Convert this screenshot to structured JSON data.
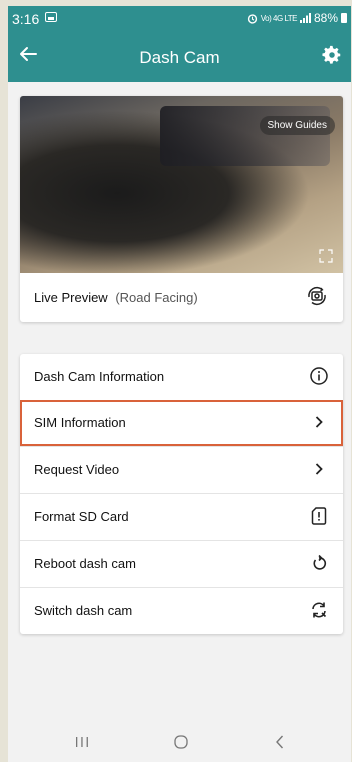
{
  "status_bar": {
    "time": "3:16",
    "network_label": "Vo) 4G LTE",
    "battery": "88%"
  },
  "header": {
    "title": "Dash Cam"
  },
  "preview": {
    "show_guides_label": "Show Guides",
    "label": "Live Preview",
    "sub_label": "(Road Facing)"
  },
  "menu": {
    "items": [
      {
        "label": "Dash Cam Information",
        "icon": "info-icon"
      },
      {
        "label": "SIM Information",
        "icon": "chevron-right-icon",
        "highlighted": true
      },
      {
        "label": "Request Video",
        "icon": "chevron-right-icon"
      },
      {
        "label": "Format SD Card",
        "icon": "sd-card-alert-icon"
      },
      {
        "label": "Reboot dash cam",
        "icon": "restart-icon"
      },
      {
        "label": "Switch dash cam",
        "icon": "switch-icon"
      }
    ]
  },
  "colors": {
    "header": "#2e8f8f",
    "highlight_border": "#d9623a"
  }
}
